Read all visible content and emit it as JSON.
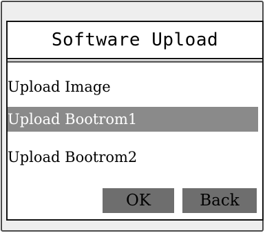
{
  "dialog": {
    "title": "Software Upload"
  },
  "menu": {
    "items": [
      {
        "label": "Upload Image",
        "selected": false
      },
      {
        "label": "Upload Bootrom1",
        "selected": true
      },
      {
        "label": "Upload Bootrom2",
        "selected": false
      }
    ]
  },
  "buttons": {
    "ok_label": "OK",
    "back_label": "Back"
  },
  "colors": {
    "selection_highlight": "#8a8a8a",
    "button_fill": "#6e6e6e",
    "selected_text": "#ffffff"
  }
}
